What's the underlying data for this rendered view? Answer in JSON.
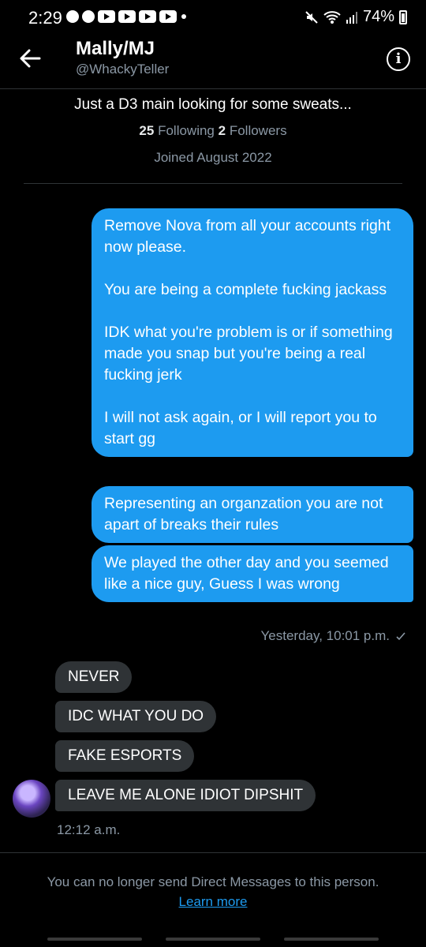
{
  "status_bar": {
    "time": "2:29",
    "battery": "74%",
    "notification_icons": [
      "facebook-icon",
      "facebook-icon",
      "youtube-icon",
      "youtube-icon",
      "youtube-icon",
      "youtube-icon"
    ]
  },
  "header": {
    "name": "Mally/MJ",
    "handle": "@WhackyTeller"
  },
  "profile": {
    "bio": "Just a D3 main looking for some sweats...",
    "following_count": "25",
    "following_label": "Following",
    "followers_count": "2",
    "followers_label": "Followers",
    "joined": "Joined August 2022"
  },
  "sent_messages": [
    {
      "text": "Remove Nova from all your accounts right now please.\n\nYou are being a complete fucking jackass\n\nIDK what you're problem is or if something made you snap but you're being a real fucking jerk\n\nI will not ask again, or I will report you to start gg"
    },
    {
      "text": "Representing an organzation you are not apart of breaks their rules"
    },
    {
      "text": "We played the other day and you seemed like a nice guy, Guess I was wrong"
    }
  ],
  "sent_time": "Yesterday, 10:01 p.m.",
  "received_messages": [
    {
      "text": "NEVER"
    },
    {
      "text": "IDC WHAT YOU DO"
    },
    {
      "text": "FAKE ESPORTS"
    },
    {
      "text": "LEAVE ME ALONE IDIOT DIPSHIT"
    }
  ],
  "received_time": "12:12 a.m.",
  "footer": {
    "note": "You can no longer send Direct Messages to this person.",
    "learn_more": "Learn more"
  },
  "colors": {
    "background": "#000000",
    "accent": "#1d9bf0",
    "received_bubble": "#2f3336",
    "secondary_text": "#8b98a5"
  }
}
